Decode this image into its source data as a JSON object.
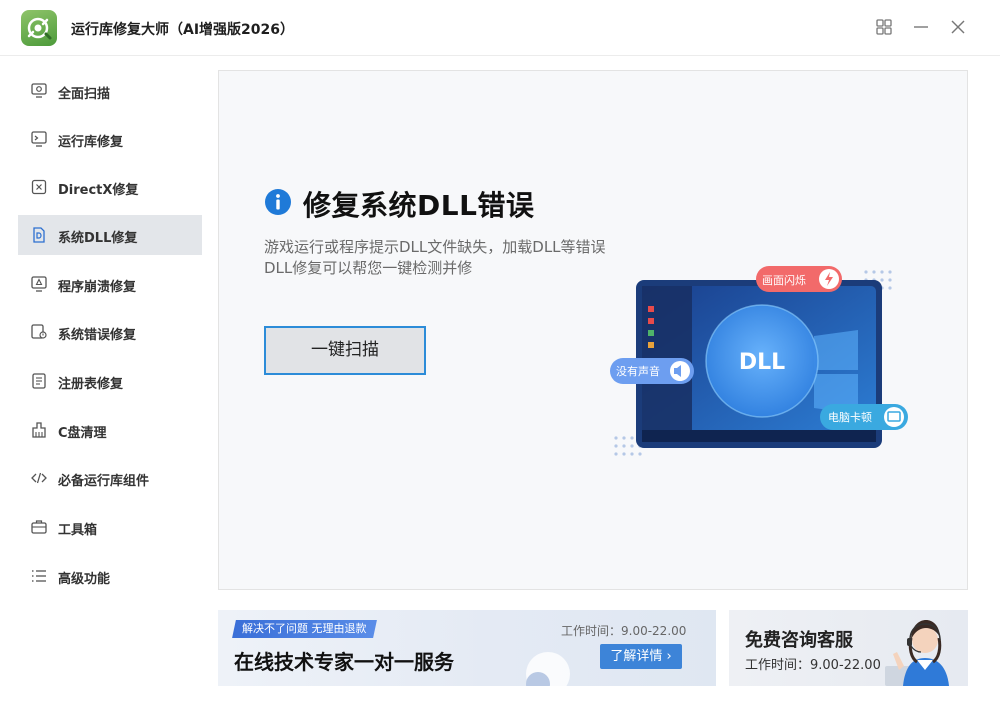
{
  "app": {
    "title": "运行库修复大师（AI增强版2026）",
    "accent": "#2c8cd8",
    "logo_color": "#5ea84a"
  },
  "window_controls": {
    "layout_icon": "grid-icon",
    "minimize_icon": "minimize-icon",
    "close_icon": "close-icon"
  },
  "sidebar": {
    "active_index": 3,
    "items": [
      {
        "label": "全面扫描",
        "icon": "monitor-scan-icon"
      },
      {
        "label": "运行库修复",
        "icon": "terminal-icon"
      },
      {
        "label": "DirectX修复",
        "icon": "x-box-icon"
      },
      {
        "label": "系统DLL修复",
        "icon": "dll-file-icon"
      },
      {
        "label": "程序崩溃修复",
        "icon": "crash-monitor-icon"
      },
      {
        "label": "系统错误修复",
        "icon": "system-error-icon"
      },
      {
        "label": "注册表修复",
        "icon": "registry-doc-icon"
      },
      {
        "label": "C盘清理",
        "icon": "disk-clean-icon"
      },
      {
        "label": "必备运行库组件",
        "icon": "code-icon"
      },
      {
        "label": "工具箱",
        "icon": "toolbox-icon"
      },
      {
        "label": "高级功能",
        "icon": "list-icon"
      }
    ]
  },
  "main": {
    "title": "修复系统DLL错误",
    "desc_line1": "游戏运行或程序提示DLL文件缺失，加载DLL等错误",
    "desc_line2": "DLL修复可以帮您一键检测并修",
    "scan_button": "一键扫描",
    "illustration": {
      "center_label": "DLL",
      "pill_top": "画面闪烁",
      "pill_left": "没有声音",
      "pill_right": "电脑卡顿"
    }
  },
  "banner_left": {
    "tag": "解决不了问题  无理由退款",
    "headline": "在线技术专家一对一服务",
    "work_hours": "工作时间：9.00-22.00",
    "detail_button": "了解详情 ›"
  },
  "banner_right": {
    "title": "免费咨询客服",
    "work_hours": "工作时间：9.00-22.00"
  }
}
